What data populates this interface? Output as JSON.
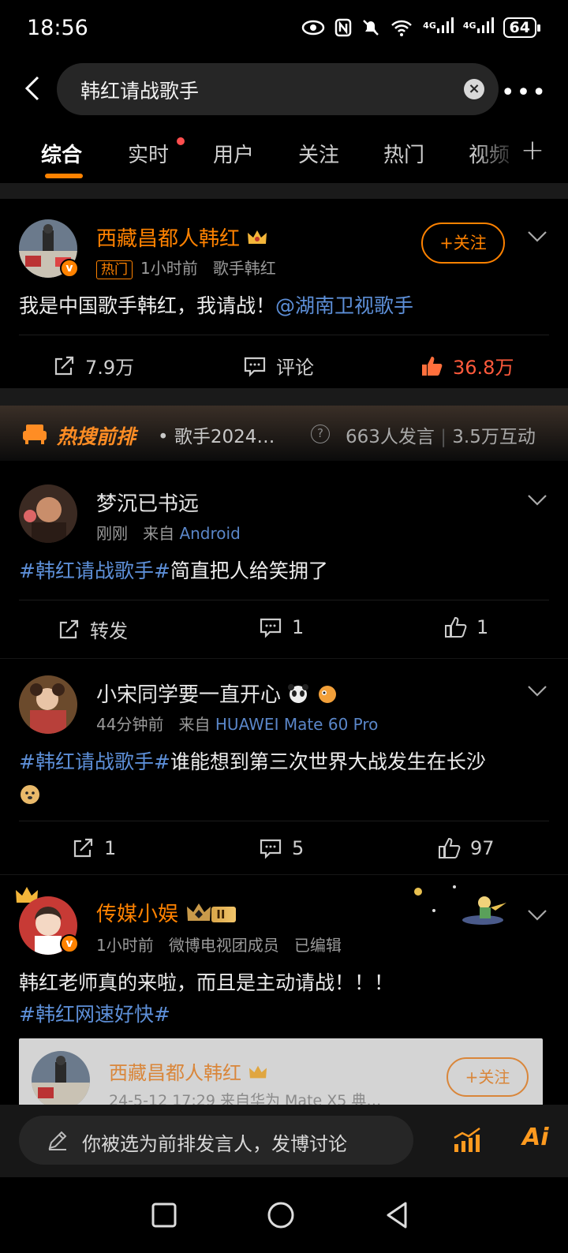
{
  "status_bar": {
    "time": "18:56",
    "battery": "64",
    "net1": "4G",
    "net2": "4G",
    "wifi_badge": "6"
  },
  "search": {
    "query": "韩红请战歌手"
  },
  "tabs": [
    {
      "label": "综合",
      "active": true
    },
    {
      "label": "实时",
      "has_dot": true
    },
    {
      "label": "用户"
    },
    {
      "label": "关注"
    },
    {
      "label": "热门"
    },
    {
      "label": "视频"
    }
  ],
  "post1": {
    "author": "西藏昌都人韩红",
    "hot_badge": "热门",
    "time": "1小时前",
    "subtitle": "歌手韩红",
    "follow_label": "+关注",
    "text_plain": "我是中国歌手韩红，我请战！",
    "text_mention": "@湖南卫视歌手",
    "reposts": "7.9万",
    "comments": "评论",
    "likes": "36.8万"
  },
  "hot_bar": {
    "label": "热搜前排",
    "topic": "• 歌手2024…",
    "speakers": "663人发言",
    "separator": "|",
    "interactions": "3.5万互动"
  },
  "post2": {
    "author": "梦沉已书远",
    "time": "刚刚",
    "from_label": "来自",
    "source": "Android",
    "topic": "#韩红请战歌手#",
    "text": "简直把人给笑拥了",
    "reposts": "转发",
    "comments": "1",
    "likes": "1"
  },
  "post3": {
    "author": "小宋同学要一直开心",
    "time": "44分钟前",
    "from_label": "来自",
    "source": "HUAWEI Mate 60 Pro",
    "topic": "#韩红请战歌手#",
    "text": "谁能想到第三次世界大战发生在长沙",
    "reposts": "1",
    "comments": "5",
    "likes": "97"
  },
  "post4": {
    "author": "传媒小娱",
    "level_badge": "II",
    "time": "1小时前",
    "role": "微博电视团成员",
    "edited": "已编辑",
    "text": "韩红老师真的来啦，而且是主动请战！！！",
    "topic": "#韩红网速好快#",
    "quoted_author": "西藏昌都人韩红",
    "quoted_time": "24-5-12 17:29",
    "quoted_source": "来自华为 Mate X5 典…",
    "quoted_follow": "+关注"
  },
  "bottom": {
    "placeholder": "你被选为前排发言人，发博讨论",
    "ai_label": "Ai"
  },
  "colors": {
    "accent": "#ff8200",
    "topic_blue": "#5d8fd8",
    "like_red": "#ff5a3c"
  }
}
